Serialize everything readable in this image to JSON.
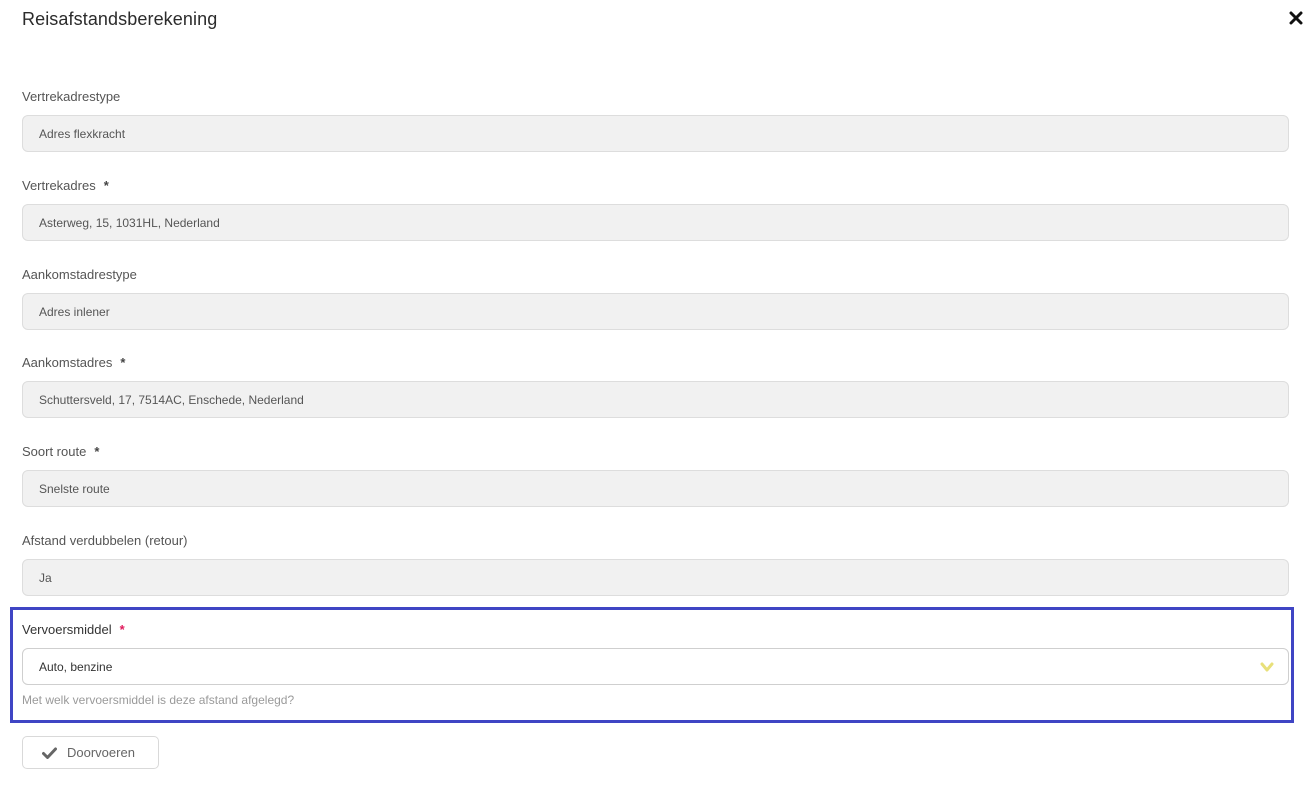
{
  "dialog": {
    "title": "Reisafstandsberekening",
    "close_icon": "close-icon"
  },
  "fields": {
    "vertrekadrestype": {
      "label": "Vertrekadrestype",
      "value": "Adres flexkracht"
    },
    "vertrekadres": {
      "label": "Vertrekadres",
      "required_mark": "*",
      "value": "Asterweg, 15, 1031HL, Nederland"
    },
    "aankomstadrestype": {
      "label": "Aankomstadrestype",
      "value": "Adres inlener"
    },
    "aankomstadres": {
      "label": "Aankomstadres",
      "required_mark": "*",
      "value": "Schuttersveld, 17, 7514AC, Enschede, Nederland"
    },
    "soort_route": {
      "label": "Soort route",
      "required_mark": "*",
      "value": "Snelste route"
    },
    "afstand_verdubbelen": {
      "label": "Afstand verdubbelen (retour)",
      "value": "Ja"
    },
    "vervoersmiddel": {
      "label": "Vervoersmiddel",
      "required_mark": "*",
      "selected": "Auto, benzine",
      "help": "Met welk vervoersmiddel is deze afstand afgelegd?"
    }
  },
  "actions": {
    "submit_label": "Doorvoeren",
    "submit_icon": "check-icon"
  },
  "colors": {
    "highlight_border": "#3f45c4",
    "required_accent": "#e0195b",
    "chevron": "#e8e07a"
  }
}
